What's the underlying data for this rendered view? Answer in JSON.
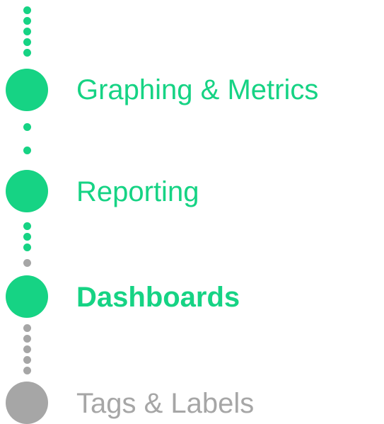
{
  "steps": [
    {
      "label": "Graphing & Metrics",
      "state": "completed"
    },
    {
      "label": "Reporting",
      "state": "completed"
    },
    {
      "label": "Dashboards",
      "state": "current"
    },
    {
      "label": "Tags & Labels",
      "state": "upcoming"
    }
  ],
  "colors": {
    "completed": "#16d384",
    "upcoming": "#a6a6a6"
  }
}
